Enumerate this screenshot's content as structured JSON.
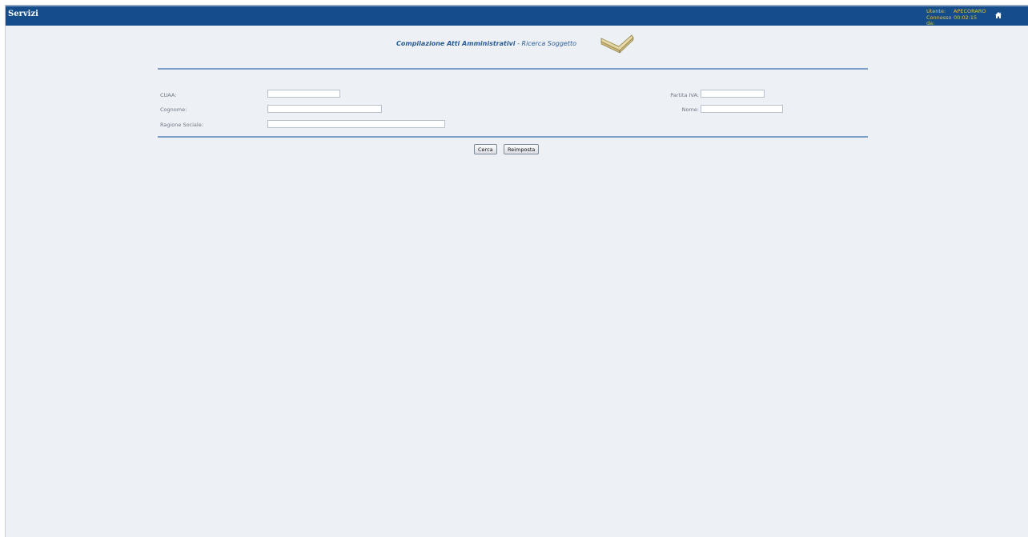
{
  "header": {
    "app_title": "Servizi",
    "user_label": "Utente:",
    "user_value": "APECORARO",
    "connected_label": "Connesso da:",
    "connected_value": "00:02:15",
    "home_icon": "home-icon"
  },
  "page": {
    "title_main": "Compilazione Atti Amministrativi",
    "title_separator": " - ",
    "title_sub": "Ricerca Soggetto",
    "title_icon": "book-icon"
  },
  "form": {
    "cuaa_label": "CUAA:",
    "cuaa_value": "",
    "cognome_label": "Cognome:",
    "cognome_value": "",
    "ragione_sociale_label": "Ragione Sociale:",
    "ragione_sociale_value": "",
    "partita_iva_label": "Partita IVA:",
    "partita_iva_value": "",
    "nome_label": "Nome:",
    "nome_value": ""
  },
  "actions": {
    "search_label": "Cerca",
    "reset_label": "Reimposta"
  },
  "colors": {
    "topbar": "#154d8a",
    "background": "#edf1f6",
    "rule": "#7e9fc5",
    "title_text": "#2a5b93",
    "session_text": "#d7c24a"
  }
}
